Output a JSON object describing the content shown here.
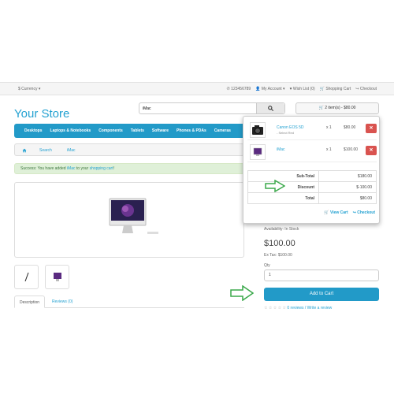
{
  "topbar": {
    "currency": "$ Currency ▾",
    "phone": "✆ 123456789",
    "account": "👤 My Account ▾",
    "wishlist": "♥ Wish List (0)",
    "cart": "🛒 Shopping Cart",
    "checkout": "↪ Checkout"
  },
  "logo": "Your Store",
  "search": {
    "value": "iMac",
    "button_icon": "search-icon"
  },
  "cart_button": "🛒 2 item(s) - $80.00",
  "nav": [
    "Desktops",
    "Laptops & Notebooks",
    "Components",
    "Tablets",
    "Software",
    "Phones & PDAs",
    "Cameras"
  ],
  "breadcrumb": {
    "home_icon": "home-icon",
    "items": [
      "Search",
      "iMac"
    ]
  },
  "alert": {
    "prefix": "Success: You have added ",
    "product": "iMac",
    "middle": " to your ",
    "cart": "shopping cart",
    "suffix": "!"
  },
  "product": {
    "availability": "Availability: In Stock",
    "price": "$100.00",
    "ex_tax": "Ex Tax: $100.00",
    "qty_label": "Qty",
    "qty_value": "1",
    "add_to_cart": "Add to Cart",
    "reviews": "0 reviews / Write a review"
  },
  "tabs": [
    "Description",
    "Reviews (0)"
  ],
  "dropdown": {
    "items": [
      {
        "name": "Canon EOS 5D",
        "option": "- Select Red",
        "qty": "x 1",
        "amount": "$80.00",
        "remove": "✕"
      },
      {
        "name": "iMac",
        "option": "",
        "qty": "x 1",
        "amount": "$100.00",
        "remove": "✕"
      }
    ],
    "totals": [
      {
        "label": "Sub-Total",
        "value": "$180.00"
      },
      {
        "label": "Discount",
        "value": "$-100.00"
      },
      {
        "label": "Total",
        "value": "$80.00"
      }
    ],
    "view_cart": "🛒 View Cart",
    "checkout": "↪ Checkout"
  },
  "colors": {
    "accent": "#229ac8",
    "arrow": "#3aa84a",
    "remove": "#d9534f"
  }
}
